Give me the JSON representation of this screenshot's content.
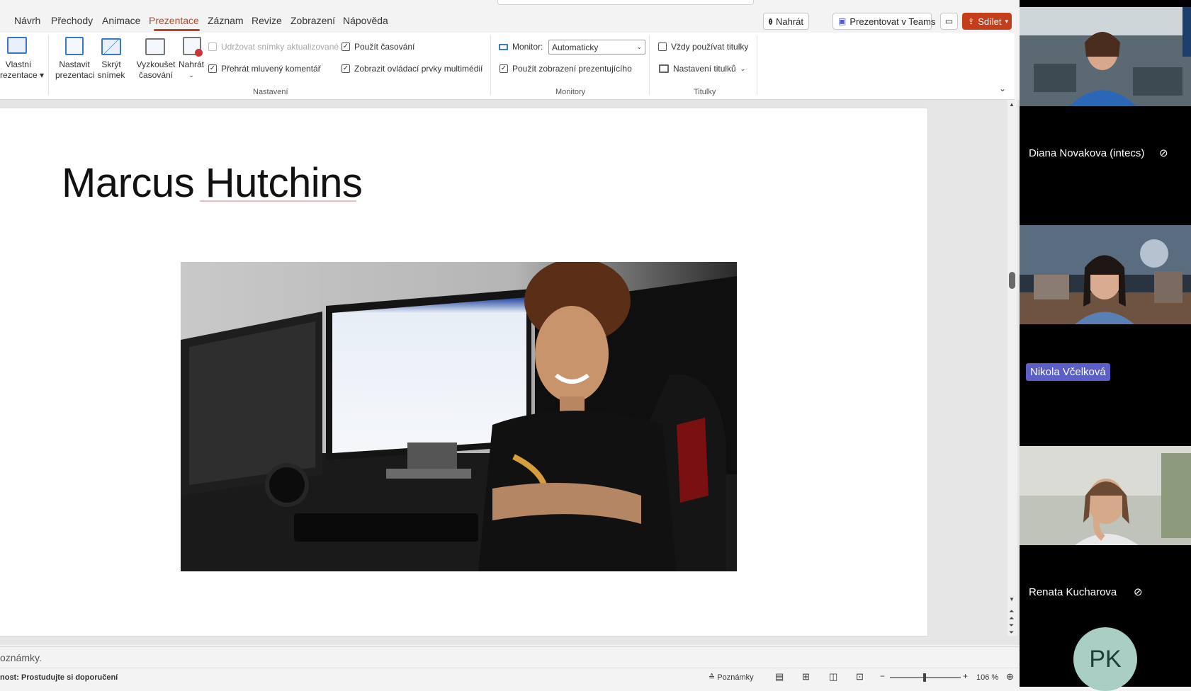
{
  "ribbon_tabs": [
    {
      "label": "Návrh"
    },
    {
      "label": "Přechody"
    },
    {
      "label": "Animace"
    },
    {
      "label": "Prezentace",
      "active": true
    },
    {
      "label": "Záznam"
    },
    {
      "label": "Revize"
    },
    {
      "label": "Zobrazení"
    },
    {
      "label": "Nápověda"
    }
  ],
  "top_buttons": {
    "record": "Nahrát",
    "present_teams": "Prezentovat v Teams",
    "share": "Sdílet"
  },
  "ribbon": {
    "custom_show": [
      "Vlastní",
      "rezentace"
    ],
    "setup_show": [
      "Nastavit",
      "prezentaci"
    ],
    "hide_slide": [
      "Skrýt",
      "snímek"
    ],
    "rehearse": [
      "Vyzkoušet",
      "časování"
    ],
    "record": "Nahrát",
    "keep_updated": "Udržovat snímky aktualizované",
    "play_narration": "Přehrát mluvený komentář",
    "use_timings": "Použít časování",
    "show_media_controls": "Zobrazit ovládací prvky multimédií",
    "group_setup": "Nastavení",
    "monitor_label": "Monitor:",
    "monitor_value": "Automaticky",
    "use_presenter_view": "Použít zobrazení prezentujícího",
    "group_monitors": "Monitory",
    "always_subtitles": "Vždy používat titulky",
    "subtitle_settings": "Nastavení titulků",
    "group_subtitles": "Titulky",
    "checks": {
      "keep_updated": false,
      "play_narration": true,
      "use_timings": true,
      "show_media_controls": true,
      "use_presenter_view": true,
      "always_subtitles": false
    }
  },
  "slide": {
    "title": "Marcus Hutchins"
  },
  "notes_placeholder": "oznámky.",
  "status": {
    "left_text": "nost: Prostudujte si doporučení",
    "notes_button": "Poznámky",
    "zoom": "106 %"
  },
  "participants": [
    {
      "name": "Diana Novakova (intecs)"
    },
    {
      "name": "Nikola Včelková"
    },
    {
      "name": "Renata Kucharova"
    },
    {
      "initials": "PK"
    }
  ],
  "colors": {
    "accent": "#b7472a",
    "share": "#c43e1c",
    "teams_badge": "#5b5fc7"
  }
}
